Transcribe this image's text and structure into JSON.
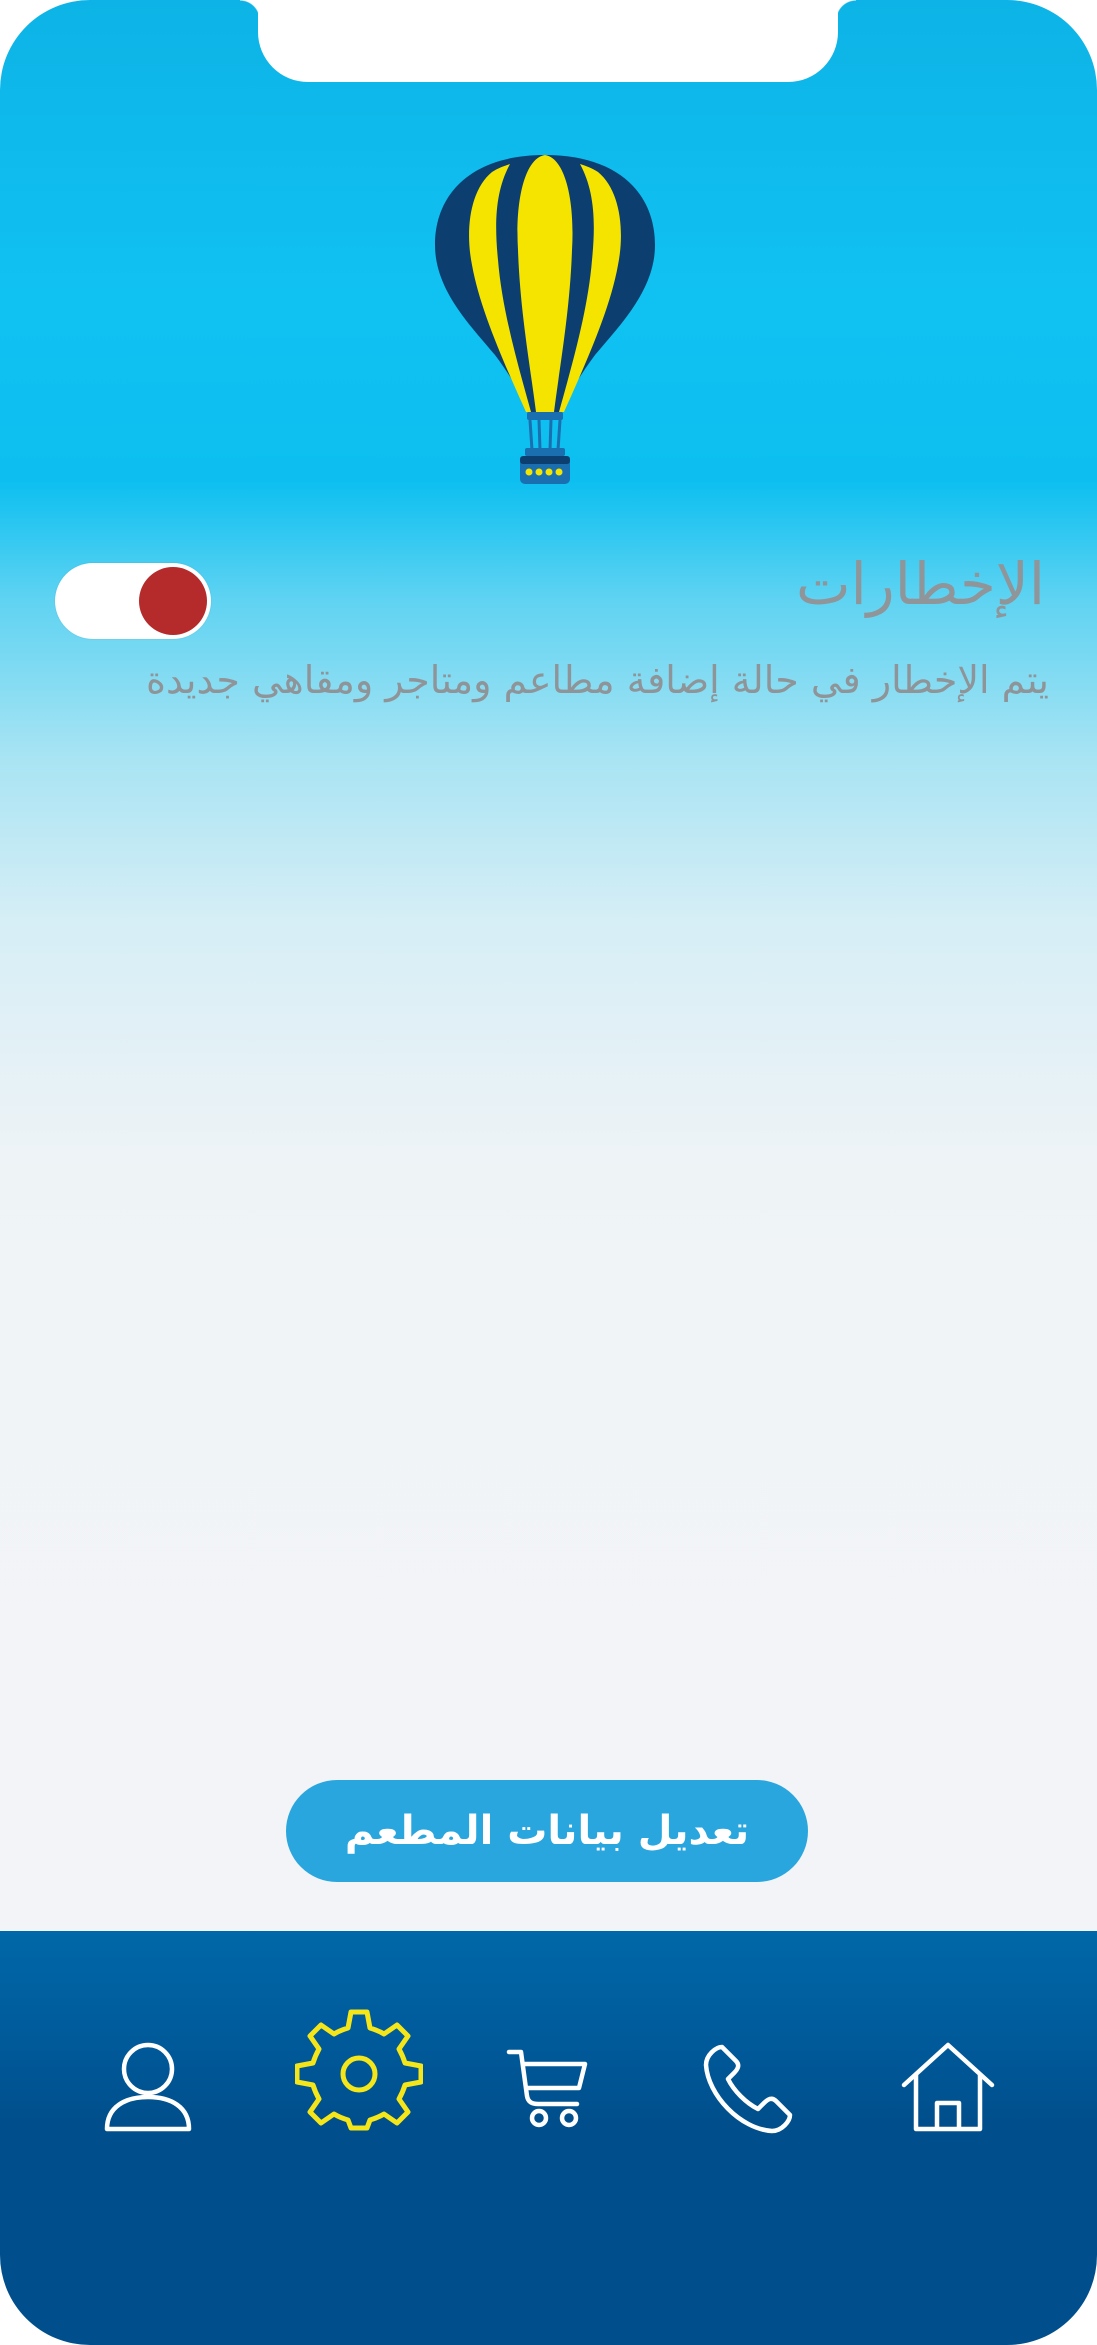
{
  "header": {
    "logo_icon": "hot-air-balloon-icon"
  },
  "notifications": {
    "title": "الإخطارات",
    "description": "يتم الإخطار في حالة إضافة مطاعم ومتاجر ومقاهي جديدة",
    "toggle_state": "on",
    "toggle_color": "#b52a2a"
  },
  "actions": {
    "edit_restaurant_label": "تعديل بيانات المطعم"
  },
  "bottom_nav": {
    "active_item": "settings",
    "active_color": "#f5e61a",
    "items": [
      {
        "id": "profile",
        "icon": "user-icon"
      },
      {
        "id": "settings",
        "icon": "gear-icon"
      },
      {
        "id": "cart",
        "icon": "cart-icon"
      },
      {
        "id": "call",
        "icon": "phone-icon"
      },
      {
        "id": "home",
        "icon": "home-icon"
      }
    ]
  },
  "colors": {
    "primary": "#2aa6df",
    "nav_background": "#004f8c",
    "text_muted": "#909599"
  }
}
